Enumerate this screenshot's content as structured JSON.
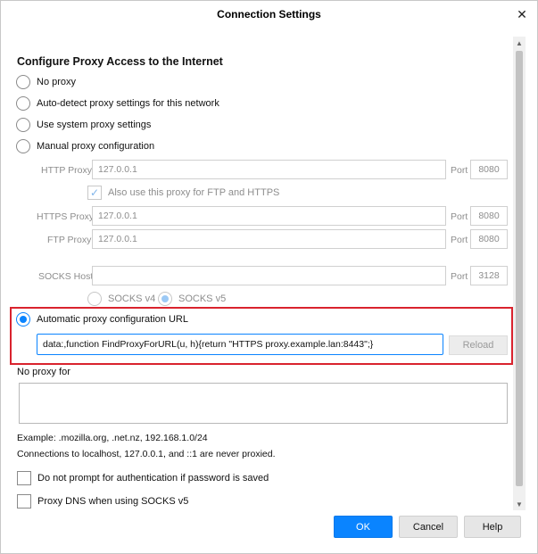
{
  "window": {
    "title": "Connection Settings",
    "close_glyph": "✕"
  },
  "heading": "Configure Proxy Access to the Internet",
  "proxy_options": [
    {
      "label": "No proxy",
      "checked": false
    },
    {
      "label": "Auto-detect proxy settings for this network",
      "checked": false
    },
    {
      "label": "Use system proxy settings",
      "checked": false
    },
    {
      "label": "Manual proxy configuration",
      "checked": false
    }
  ],
  "manual": {
    "http_label": "HTTP Proxy",
    "http_value": "127.0.0.1",
    "http_port_label": "Port",
    "http_port": "8080",
    "also_use_label": "Also use this proxy for FTP and HTTPS",
    "also_use_checked": true,
    "https_label": "HTTPS Proxy",
    "https_value": "127.0.0.1",
    "https_port_label": "Port",
    "https_port": "8080",
    "ftp_label": "FTP Proxy",
    "ftp_value": "127.0.0.1",
    "ftp_port_label": "Port",
    "ftp_port": "8080",
    "socks_label": "SOCKS Host",
    "socks_value": "",
    "socks_port_label": "Port",
    "socks_port": "3128",
    "socks_v4": "SOCKS v4",
    "socks_v5": "SOCKS v5"
  },
  "pac": {
    "label": "Automatic proxy configuration URL",
    "checked": true,
    "url": "data:,function FindProxyForURL(u, h){return \"HTTPS proxy.example.lan:8443\";}",
    "reload_label": "Reload"
  },
  "no_proxy": {
    "label": "No proxy for",
    "value": "",
    "example": "Example: .mozilla.org, .net.nz, 192.168.1.0/24",
    "note": "Connections to localhost, 127.0.0.1, and ::1 are never proxied."
  },
  "checks": [
    {
      "label": "Do not prompt for authentication if password is saved",
      "checked": false
    },
    {
      "label": "Proxy DNS when using SOCKS v5",
      "checked": false
    }
  ],
  "footer": {
    "ok": "OK",
    "cancel": "Cancel",
    "help": "Help"
  },
  "colors": {
    "accent": "#0a84ff",
    "highlight_border": "#d9232e"
  }
}
